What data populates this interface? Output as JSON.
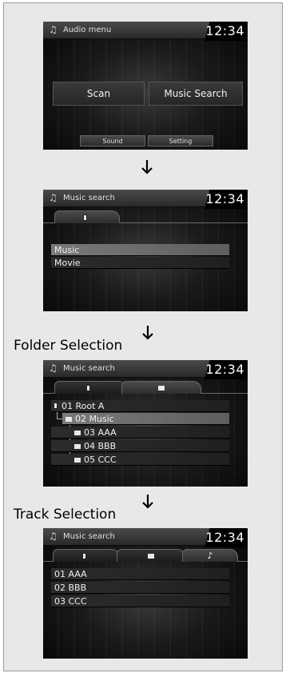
{
  "clock": "12:34",
  "screen1": {
    "title": "Audio menu",
    "title_icon": "♫",
    "scan_label": "Scan",
    "music_search_label": "Music Search",
    "sound_label": "Sound",
    "setting_label": "Setting"
  },
  "screen2": {
    "title": "Music search",
    "title_icon": "♫",
    "items": [
      "Music",
      "Movie"
    ]
  },
  "step_folder": "Folder Selection",
  "screen3": {
    "title": "Music search",
    "title_icon": "♫",
    "items": [
      "01 Root A",
      "02 Music",
      "03 AAA",
      "04 BBB",
      "05 CCC"
    ]
  },
  "step_track": "Track Selection",
  "screen4": {
    "title": "Music search",
    "title_icon": "♫",
    "tab_note": "♪",
    "items": [
      "01 AAA",
      "02 BBB",
      "03 CCC"
    ]
  },
  "colors": {
    "selected_row": "#6e6e6e",
    "background": "#e8e8e8"
  }
}
